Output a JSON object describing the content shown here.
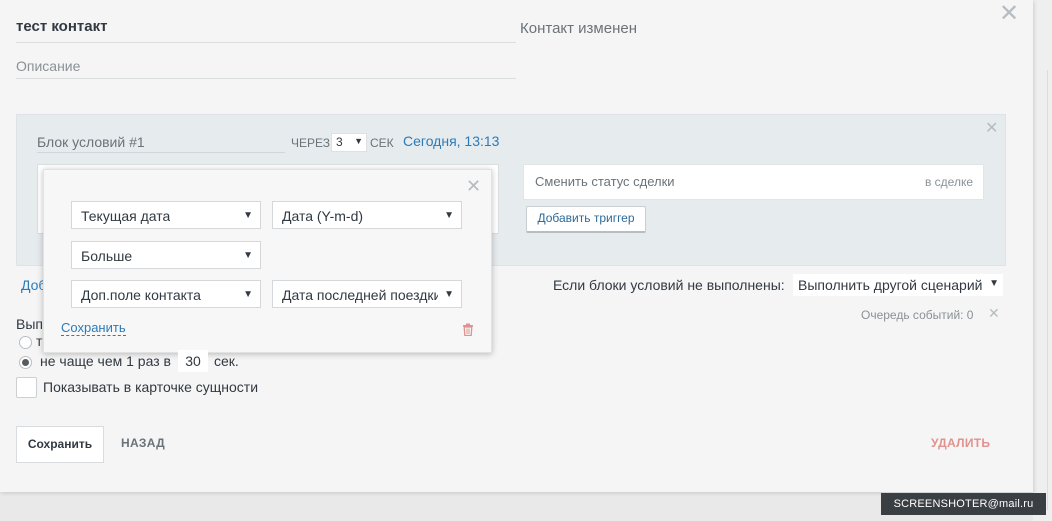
{
  "header": {
    "title": "тест контакт",
    "description_placeholder": "Описание",
    "status": "Контакт изменен"
  },
  "condition_block": {
    "name": "Блок условий #1",
    "through_label": "ЧЕРЕЗ",
    "delay_value": "3",
    "seconds_label": "СЕК",
    "run_time": "Сегодня, 13:13"
  },
  "popup": {
    "row1": {
      "field": "Текущая дата",
      "format": "Дата (Y-m-d)"
    },
    "row2": {
      "operator": "Больше"
    },
    "row3": {
      "source": "Доп.поле контакта",
      "field": "Дата последней поездки"
    },
    "save_label": "Сохранить"
  },
  "action": {
    "label": "Сменить статус сделки",
    "target": "в сделке",
    "add_trigger": "Добавить триггер"
  },
  "add_block_label": "Добавить",
  "fallback": {
    "label": "Если блоки условий не выполнены:",
    "value": "Выполнить другой сценарий"
  },
  "queue": "Очередь событий: 0",
  "execution": {
    "label": "Выполнять",
    "radio1": "т",
    "radio2_prefix": "не чаще чем 1 раз в",
    "interval": "30",
    "radio2_suffix": "сек.",
    "show_in_card": "Показывать в карточке сущности"
  },
  "footer": {
    "save": "Сохранить",
    "back": "НАЗАД",
    "delete": "УДАЛИТЬ"
  },
  "watermark": "SCREENSHOTER@mail.ru",
  "colors": {
    "link": "#2c7ab8",
    "delete": "#e0928f",
    "trash": "#e0928f"
  }
}
